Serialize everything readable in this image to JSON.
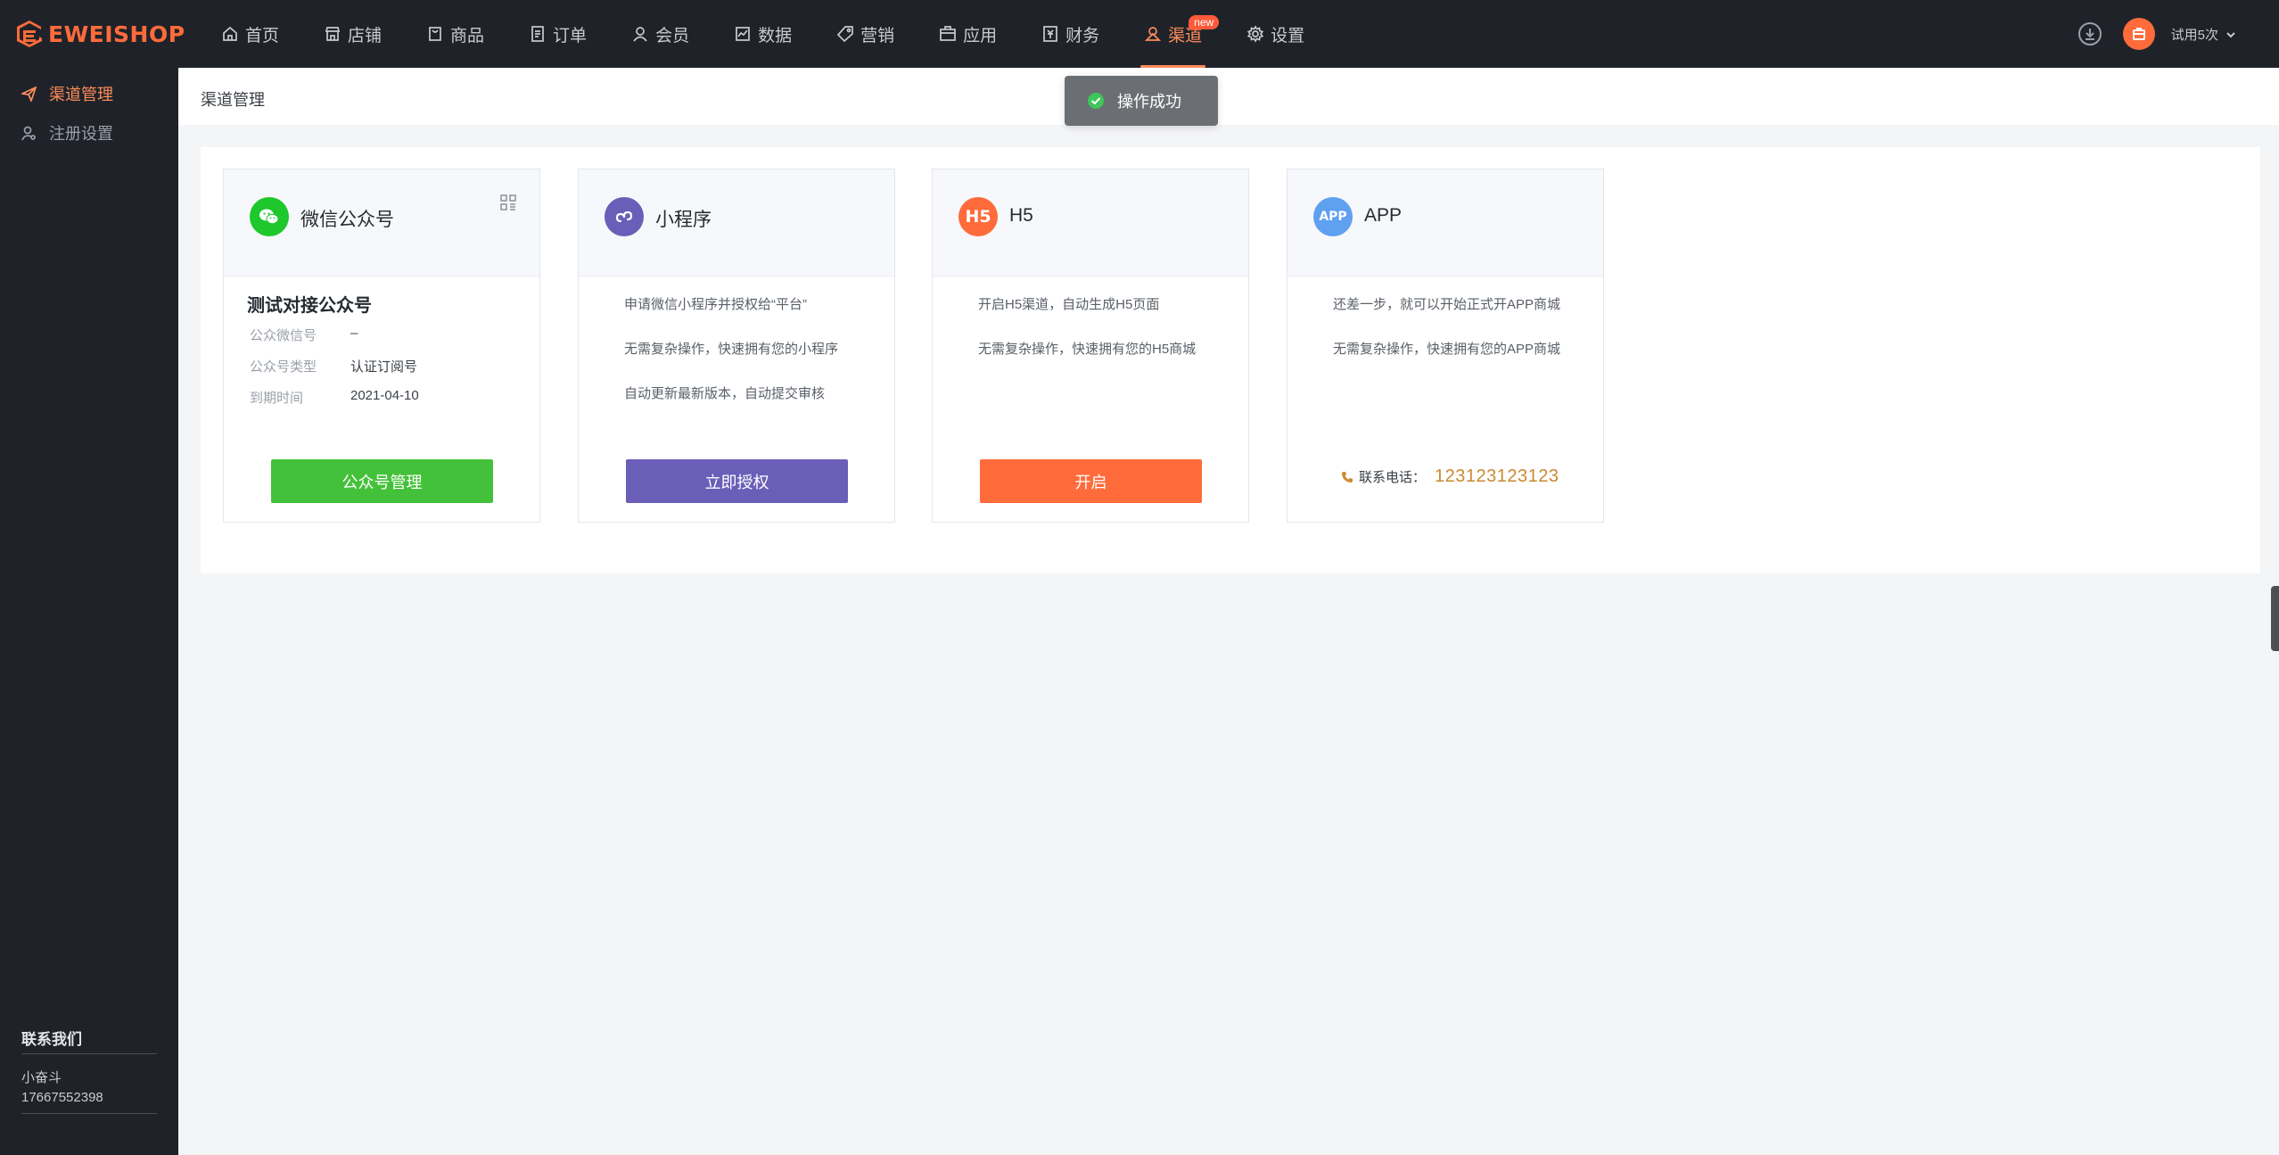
{
  "brand": {
    "name": "EWEISHOP",
    "accent": "#ff6b3a"
  },
  "nav": {
    "items": [
      {
        "label": "首页",
        "icon": "home-icon"
      },
      {
        "label": "店铺",
        "icon": "store-icon"
      },
      {
        "label": "商品",
        "icon": "goods-icon"
      },
      {
        "label": "订单",
        "icon": "order-icon"
      },
      {
        "label": "会员",
        "icon": "member-icon"
      },
      {
        "label": "数据",
        "icon": "chart-icon"
      },
      {
        "label": "营销",
        "icon": "tag-icon"
      },
      {
        "label": "应用",
        "icon": "app-box-icon"
      },
      {
        "label": "财务",
        "icon": "finance-icon"
      },
      {
        "label": "渠道",
        "icon": "channel-icon",
        "active": true,
        "badge": "new"
      },
      {
        "label": "设置",
        "icon": "gear-icon"
      }
    ],
    "trial_label": "试用5次"
  },
  "sidebar": {
    "items": [
      {
        "label": "渠道管理",
        "icon": "send-icon",
        "active": true
      },
      {
        "label": "注册设置",
        "icon": "user-settings-icon"
      }
    ],
    "contact": {
      "title": "联系我们",
      "name": "小奋斗",
      "phone": "17667552398"
    }
  },
  "main": {
    "breadcrumb": "渠道管理",
    "toast": "操作成功",
    "cards": [
      {
        "title": "微信公众号",
        "account_name": "测试对接公众号",
        "info": [
          {
            "label": "公众微信号",
            "value": "–"
          },
          {
            "label": "公众号类型",
            "value": "认证订阅号"
          },
          {
            "label": "到期时间",
            "value": "2021-04-10"
          }
        ],
        "button": "公众号管理"
      },
      {
        "title": "小程序",
        "lines": [
          "申请微信小程序并授权给“平台”",
          "无需复杂操作，快速拥有您的小程序",
          "自动更新最新版本，自动提交审核"
        ],
        "button": "立即授权"
      },
      {
        "title": "H5",
        "icon_text": "H5",
        "lines": [
          "开启H5渠道，自动生成H5页面",
          "无需复杂操作，快速拥有您的H5商城"
        ],
        "button": "开启"
      },
      {
        "title": "APP",
        "icon_text": "APP",
        "lines": [
          "还差一步，就可以开始正式开APP商城",
          "无需复杂操作，快速拥有您的APP商城"
        ],
        "phone_label": "联系电话：",
        "phone_number": "123123123123"
      }
    ]
  }
}
